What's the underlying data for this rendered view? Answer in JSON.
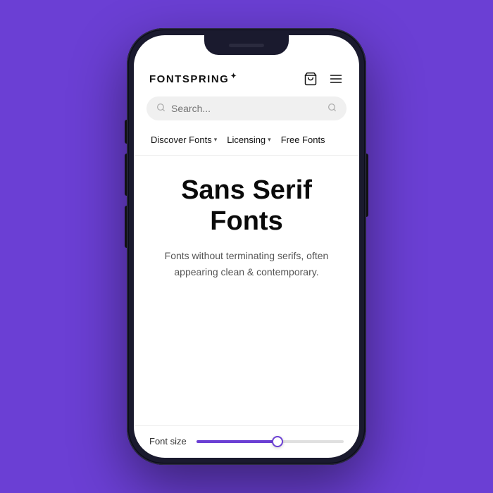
{
  "background": {
    "color": "#6b3fd4"
  },
  "phone": {
    "header": {
      "logo": "FONTSPRING",
      "logo_leaf": "✦",
      "cart_icon": "cart-icon",
      "menu_icon": "menu-icon"
    },
    "search": {
      "placeholder": "Search..."
    },
    "nav": {
      "items": [
        {
          "label": "Discover Fonts",
          "has_chevron": true
        },
        {
          "label": "Licensing",
          "has_chevron": true
        },
        {
          "label": "Free Fonts",
          "has_chevron": false
        }
      ]
    },
    "hero": {
      "title": "Sans Serif Fonts",
      "subtitle": "Fonts without terminating serifs, often appearing clean & contemporary."
    },
    "font_size": {
      "label": "Font size",
      "slider_percent": 55
    }
  }
}
